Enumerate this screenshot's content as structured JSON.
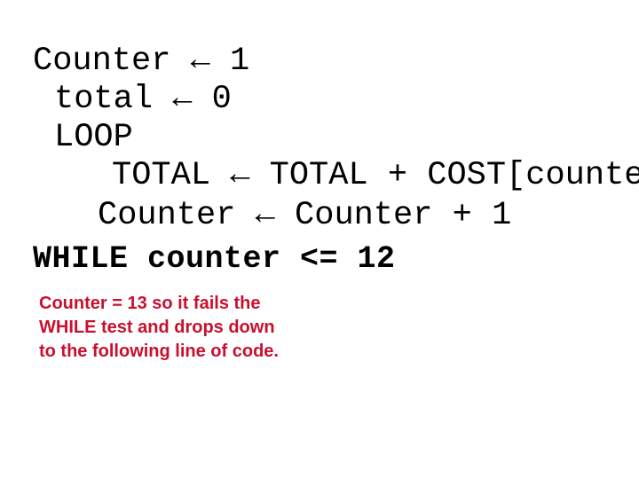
{
  "slide": {
    "background_color": "#ffffff",
    "code": {
      "text_color": "#000000",
      "lines": [
        {
          "text": "Counter ← 1",
          "bold": false
        },
        {
          "text": "total ← 0",
          "bold": false
        },
        {
          "text": "LOOP",
          "bold": false
        },
        {
          "text": "TOTAL ← TOTAL + COST[counter]",
          "bold": false
        },
        {
          "text": "Counter ← Counter + 1",
          "bold": false
        },
        {
          "text": "WHILE counter <= 12",
          "bold": true
        }
      ]
    },
    "annotation": {
      "text_color": "#c8102e",
      "lines": [
        "Counter = 13 so it fails the",
        "WHILE test and drops down",
        "to the following line of code."
      ]
    }
  }
}
